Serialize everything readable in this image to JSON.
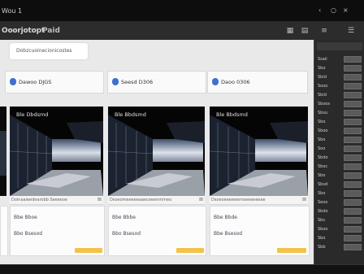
{
  "window": {
    "title": "Wou 1",
    "controls": [
      "‹",
      "○",
      "×"
    ]
  },
  "toolbar": {
    "brand": "Ooorjotopt",
    "brand_suffix": "Paid",
    "tool_icons": [
      "grid-icon",
      "doc-icon",
      "list-icon",
      "menu-icon"
    ]
  },
  "main": {
    "search_pill": "Dobzcuoinecionicostes",
    "cards": [
      {
        "header": "Dawoo DJGS",
        "image_title": "Ble Dbdsmd",
        "info": "Doinaaieedearobb Seeeeoe",
        "rows": [
          "Bbe Bboe",
          "Bbo Bsesod"
        ]
      },
      {
        "header": "Seesd D306",
        "image_title": "Ble Bbdsmd",
        "info": "Dsoeomeeeeeaaeceeenmmeo",
        "rows": [
          "Bbe Bbbe",
          "Bbo Bsesod"
        ]
      },
      {
        "header": "Daoo 0306",
        "image_title": "Ble Bbdsmd",
        "info": "Dsoeoeeeeeemoeeeeeeae",
        "rows": [
          "Bbe Bbde",
          "Bbe Bsesod"
        ]
      }
    ],
    "left_partial": {
      "image_title": "Bbo",
      "rows": [
        "Bbe",
        "Bbo"
      ]
    }
  },
  "sidebar": {
    "header": "",
    "rows": [
      "Ssaii",
      "Sbo",
      "Sbid",
      "Sooo",
      "Sbid",
      "Sboos",
      "Sbsu",
      "Sbo",
      "Sboo",
      "Sbo",
      "Soo",
      "Sbdo",
      "Sboc",
      "Sbo",
      "Sbsd",
      "Sbo",
      "Seoo",
      "Sbdo",
      "Sbs",
      "Sboo",
      "Sbo",
      "Sbb"
    ],
    "colors": {
      "panel": "#2a2a2a",
      "field": "#5a5a5a"
    }
  },
  "colors": {
    "accent_blue": "#3f6fd1",
    "tag_yellow": "#f3c24a"
  }
}
